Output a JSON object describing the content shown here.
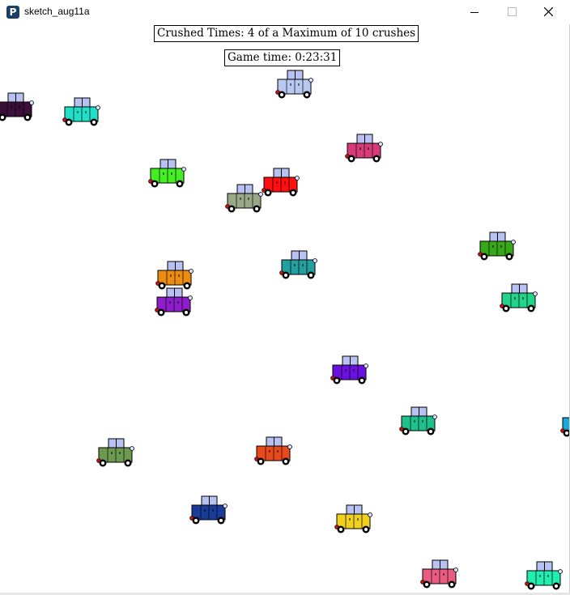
{
  "window": {
    "title": "sketch_aug11a",
    "app_icon_glyph": "P"
  },
  "hud": {
    "crushed_text": "Crushed Times: 4 of a Maximum of 10 crushes",
    "time_text": "Game time: 0:23:31"
  },
  "colors": {
    "cabin": "#b8c2f2",
    "wheel": "#000000",
    "hub": "#ffffff",
    "taillight": "#c01010",
    "headlight": "#d8e0ff"
  },
  "cars": [
    {
      "color": "#3a0f3a"
    },
    {
      "color": "#22e0c8"
    },
    {
      "color": "#b8c8f0"
    },
    {
      "color": "#d83c78"
    },
    {
      "color": "#44ee22"
    },
    {
      "color": "#ff1010"
    },
    {
      "color": "#98a888"
    },
    {
      "color": "#38a818"
    },
    {
      "color": "#249e9e"
    },
    {
      "color": "#ec8c10"
    },
    {
      "color": "#8e1ecc"
    },
    {
      "color": "#22d48a"
    },
    {
      "color": "#6a10e0"
    },
    {
      "color": "#20c08c"
    },
    {
      "color": "#1aa8d8"
    },
    {
      "color": "#6c9a50"
    },
    {
      "color": "#e84a1e"
    },
    {
      "color": "#1a3c98"
    },
    {
      "color": "#f0d020"
    },
    {
      "color": "#ea5c80"
    },
    {
      "color": "#22eeb0"
    }
  ]
}
